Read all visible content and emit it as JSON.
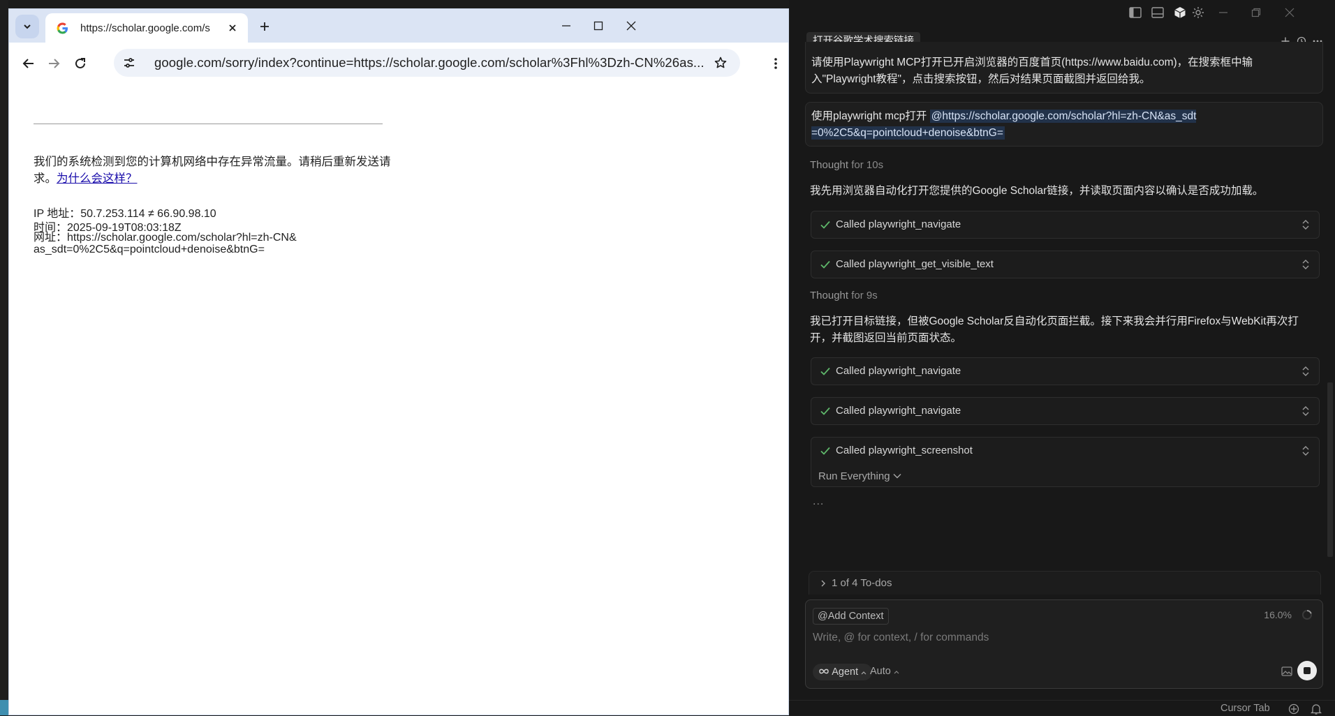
{
  "browser": {
    "tab_title": "https://scholar.google.com/s",
    "url": "google.com/sorry/index?continue=https://scholar.google.com/scholar%3Fhl%3Dzh-CN%26as...",
    "page": {
      "message": "我们的系统检测到您的计算机网络中存在异常流量。请稍后重新发送请求。",
      "why_link": "为什么会这样？",
      "ip_line": "IP 地址：50.7.253.114 ≠ 66.90.98.10",
      "time_line": "时间：2025-09-19T08:03:18Z",
      "url_line": "网址：https://scholar.google.com/scholar?hl=zh-CN&as_sdt=0%2C5&q=pointcloud+denoise&btnG="
    }
  },
  "cursor": {
    "chat_title": "打开谷歌学术搜索链接",
    "user_msg_1": "请使用Playwright MCP打开已开启浏览器的百度首页(https://www.baidu.com)，在搜索框中输入\"Playwright教程\"，点击搜索按钮，然后对结果页面截图并返回给我。",
    "user_msg_2_prefix": "使用playwright mcp打开 ",
    "user_msg_2_mention": "@https://scholar.google.com/scholar?hl=zh-CN&as_sdt=0%2C5&q=pointcloud+denoise&btnG=",
    "thought_1_label": "Thought",
    "thought_1_time": "for 10s",
    "assistant_1": "我先用浏览器自动化打开您提供的Google Scholar链接，并读取页面内容以确认是否成功加载。",
    "tool_1": "Called playwright_navigate",
    "tool_2": "Called playwright_get_visible_text",
    "thought_2_label": "Thought",
    "thought_2_time": "for 9s",
    "assistant_2": "我已打开目标链接，但被Google Scholar反自动化页面拦截。接下来我会并行用Firefox与WebKit再次打开，并截图返回当前页面状态。",
    "tool_3": "Called playwright_navigate",
    "tool_4": "Called playwright_navigate",
    "tool_5": "Called playwright_screenshot",
    "run_everything": "Run Everything",
    "ellipsis": "...",
    "todos": "1 of 4 To-dos",
    "add_context": "Add Context",
    "context_pct": "16.0%",
    "input_placeholder": "Write, @ for context, / for commands",
    "mode": "Agent",
    "model": "Auto",
    "status_cursor_tab": "Cursor Tab"
  }
}
